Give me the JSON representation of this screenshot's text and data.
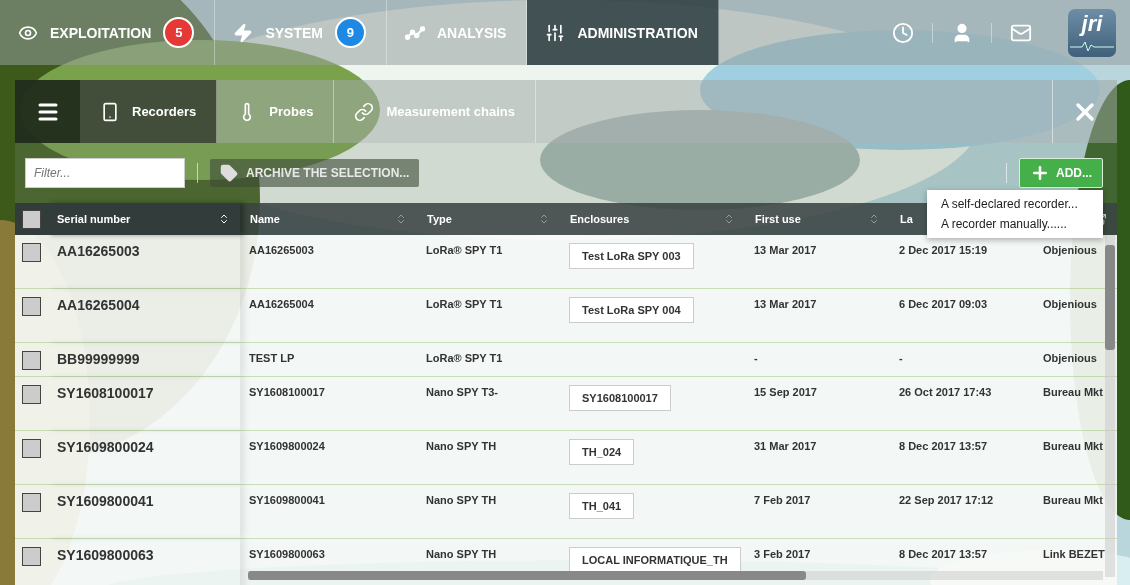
{
  "nav": {
    "tabs": [
      {
        "label": "EXPLOITATION",
        "badge": "5",
        "color": "#e53935",
        "selected": false
      },
      {
        "label": "SYSTEM",
        "badge": "9",
        "color": "#1e88e5",
        "selected": false
      },
      {
        "label": "ANALYSIS",
        "selected": false
      },
      {
        "label": "ADMINISTRATION",
        "selected": true
      }
    ],
    "logo": "jri"
  },
  "panel": {
    "tabs": [
      {
        "label": "Recorders",
        "selected": true
      },
      {
        "label": "Probes",
        "selected": false
      },
      {
        "label": "Measurement chains",
        "selected": false
      }
    ]
  },
  "toolbar": {
    "filter": {
      "placeholder": "Filter..."
    },
    "archive_button": "ARCHIVE THE SELECTION...",
    "add_button": "ADD..."
  },
  "add_menu": [
    "A self-declared recorder...",
    "A recorder manually......"
  ],
  "table": {
    "all_checked": false,
    "columns": [
      "Serial number",
      "Name",
      "Type",
      "Enclosures",
      "First use",
      "La"
    ],
    "rows": [
      {
        "checked": false,
        "serial": "AA16265003",
        "name": "AA16265003",
        "type": "LoRa® SPY T1",
        "enclosure": "Test LoRa SPY 003",
        "first_use": "13 Mar 2017",
        "last_use": "2 Dec 2017 15:19",
        "column_8": "Objenious"
      },
      {
        "checked": false,
        "serial": "AA16265004",
        "name": "AA16265004",
        "type": "LoRa® SPY T1",
        "enclosure": "Test LoRa SPY 004",
        "first_use": "13 Mar 2017",
        "last_use": "6 Dec 2017 09:03",
        "column_8": "Objenious"
      },
      {
        "checked": false,
        "serial": "BB99999999",
        "name": "TEST LP",
        "type": "LoRa® SPY T1",
        "first_use": "-",
        "last_use": "-",
        "column_8": "Objenious"
      },
      {
        "checked": false,
        "serial": "SY1608100017",
        "name": "SY1608100017",
        "type": "Nano SPY T3-",
        "enclosure": "SY1608100017",
        "first_use": "15 Sep 2017",
        "last_use": "26 Oct 2017 17:43",
        "column_8": "Bureau Mkt"
      },
      {
        "checked": false,
        "serial": "SY1609800024",
        "name": "SY1609800024",
        "type": "Nano SPY TH",
        "enclosure": "TH_024",
        "first_use": "31 Mar 2017",
        "last_use": "8 Dec 2017 13:57",
        "column_8": "Bureau Mkt"
      },
      {
        "checked": false,
        "serial": "SY1609800041",
        "name": "SY1609800041",
        "type": "Nano SPY TH",
        "enclosure": "TH_041",
        "first_use": "7 Feb 2017",
        "last_use": "22 Sep 2017 17:12",
        "column_8": "Bureau Mkt"
      },
      {
        "checked": false,
        "serial": "SY1609800063",
        "name": "SY1609800063",
        "type": "Nano SPY TH",
        "enclosure": "LOCAL INFORMATIQUE_TH",
        "first_use": "3 Feb 2017",
        "last_use": "8 Dec 2017 13:57",
        "column_8": "Link BEZET"
      }
    ]
  }
}
